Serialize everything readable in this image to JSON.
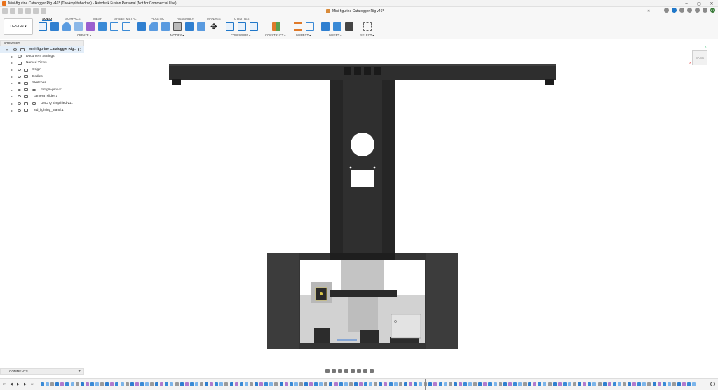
{
  "window": {
    "title": "Mini-figurine Catalogger Rig v46* (TheAmplituhedron) - Autodesk Fusion Personal (Not for Commercial Use)",
    "controls": [
      "–",
      "▢",
      "✕"
    ]
  },
  "document_tab": {
    "label": "Mini-figurine Catalogger Rig v46*",
    "close": "✕"
  },
  "account": {
    "initials": "KA"
  },
  "workspace": {
    "label": "DESIGN ▾"
  },
  "ribbon_tabs": [
    "SOLID",
    "SURFACE",
    "MESH",
    "SHEET METAL",
    "PLASTIC",
    "ASSEMBLY",
    "MANAGE",
    "UTILITIES"
  ],
  "active_tab": "SOLID",
  "tool_groups": [
    "CREATE ▾",
    "MODIFY ▾",
    "CONFIGURE ▾",
    "CONSTRUCT ▾",
    "INSPECT ▾",
    "INSERT ▾",
    "SELECT ▾"
  ],
  "browser": {
    "header": "BROWSER",
    "root": "Mini-figurine Catalogger Rig...",
    "items": [
      {
        "label": "Document Settings",
        "icon": "gear-icon"
      },
      {
        "label": "Named Views",
        "icon": "folder-icon"
      },
      {
        "label": "Origin",
        "icon": "folder-icon"
      },
      {
        "label": "Bodies",
        "icon": "folder-icon"
      },
      {
        "label": "Sketches",
        "icon": "folder-icon"
      },
      {
        "label": "mmgm-pm v11",
        "icon": "component-link-icon"
      },
      {
        "label": "camera_slider:1",
        "icon": "component-icon"
      },
      {
        "label": "UNO Q simplified v11",
        "icon": "component-link-icon"
      },
      {
        "label": "led_lighting_stand:1",
        "icon": "component-icon"
      }
    ]
  },
  "viewcube": {
    "face": "BACK",
    "axis_z": "Z",
    "axis_x": "X"
  },
  "comments": {
    "label": "COMMENTS",
    "add": "+"
  },
  "timeline": {
    "controls": [
      "⏮",
      "◀",
      "▶",
      "▶",
      "⏭"
    ]
  },
  "colors": {
    "accent": "#1f77c9",
    "model_dark": "#2b2b2b",
    "model_mid": "#3c3c3c",
    "model_light": "#c4c4c4"
  }
}
